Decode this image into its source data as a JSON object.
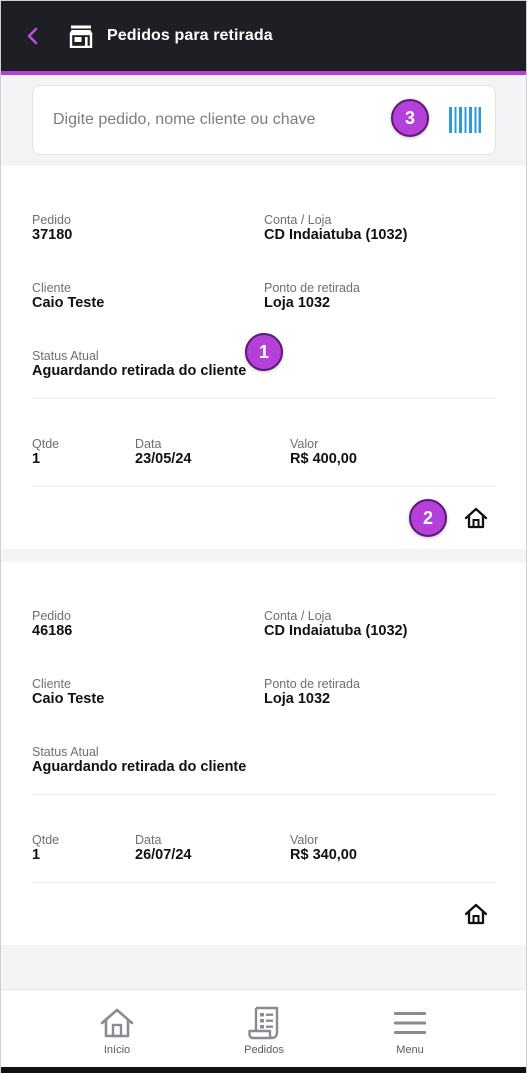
{
  "header": {
    "title": "Pedidos para retirada",
    "back_icon": "chevron-left-icon",
    "store_icon": "store-icon",
    "accent_color": "#b43fd9",
    "background_color": "#1e1f24"
  },
  "search": {
    "placeholder": "Digite pedido, nome cliente ou chave",
    "value": "",
    "scan_icon": "barcode-icon",
    "scan_icon_color": "#2a9ad8"
  },
  "markers": {
    "m1": "1",
    "m2": "2",
    "m3": "3"
  },
  "orders": [
    {
      "pedido_label": "Pedido",
      "pedido": "37180",
      "conta_label": "Conta / Loja",
      "conta": "CD Indaiatuba (1032)",
      "cliente_label": "Cliente",
      "cliente": "Caio Teste",
      "ponto_label": "Ponto de retirada",
      "ponto": "Loja 1032",
      "status_label": "Status Atual",
      "status": "Aguardando retirada do cliente",
      "qtde_label": "Qtde",
      "qtde": "1",
      "data_label": "Data",
      "data": "23/05/24",
      "valor_label": "Valor",
      "valor": "R$ 400,00",
      "action_icon": "home-icon"
    },
    {
      "pedido_label": "Pedido",
      "pedido": "46186",
      "conta_label": "Conta / Loja",
      "conta": "CD Indaiatuba (1032)",
      "cliente_label": "Cliente",
      "cliente": "Caio Teste",
      "ponto_label": "Ponto de retirada",
      "ponto": "Loja 1032",
      "status_label": "Status Atual",
      "status": "Aguardando retirada do cliente",
      "qtde_label": "Qtde",
      "qtde": "1",
      "data_label": "Data",
      "data": "26/07/24",
      "valor_label": "Valor",
      "valor": "R$ 340,00",
      "action_icon": "home-icon"
    }
  ],
  "nav": {
    "items": [
      {
        "label": "Início",
        "icon": "home-icon"
      },
      {
        "label": "Pedidos",
        "icon": "receipt-icon"
      },
      {
        "label": "Menu",
        "icon": "menu-icon"
      }
    ]
  }
}
